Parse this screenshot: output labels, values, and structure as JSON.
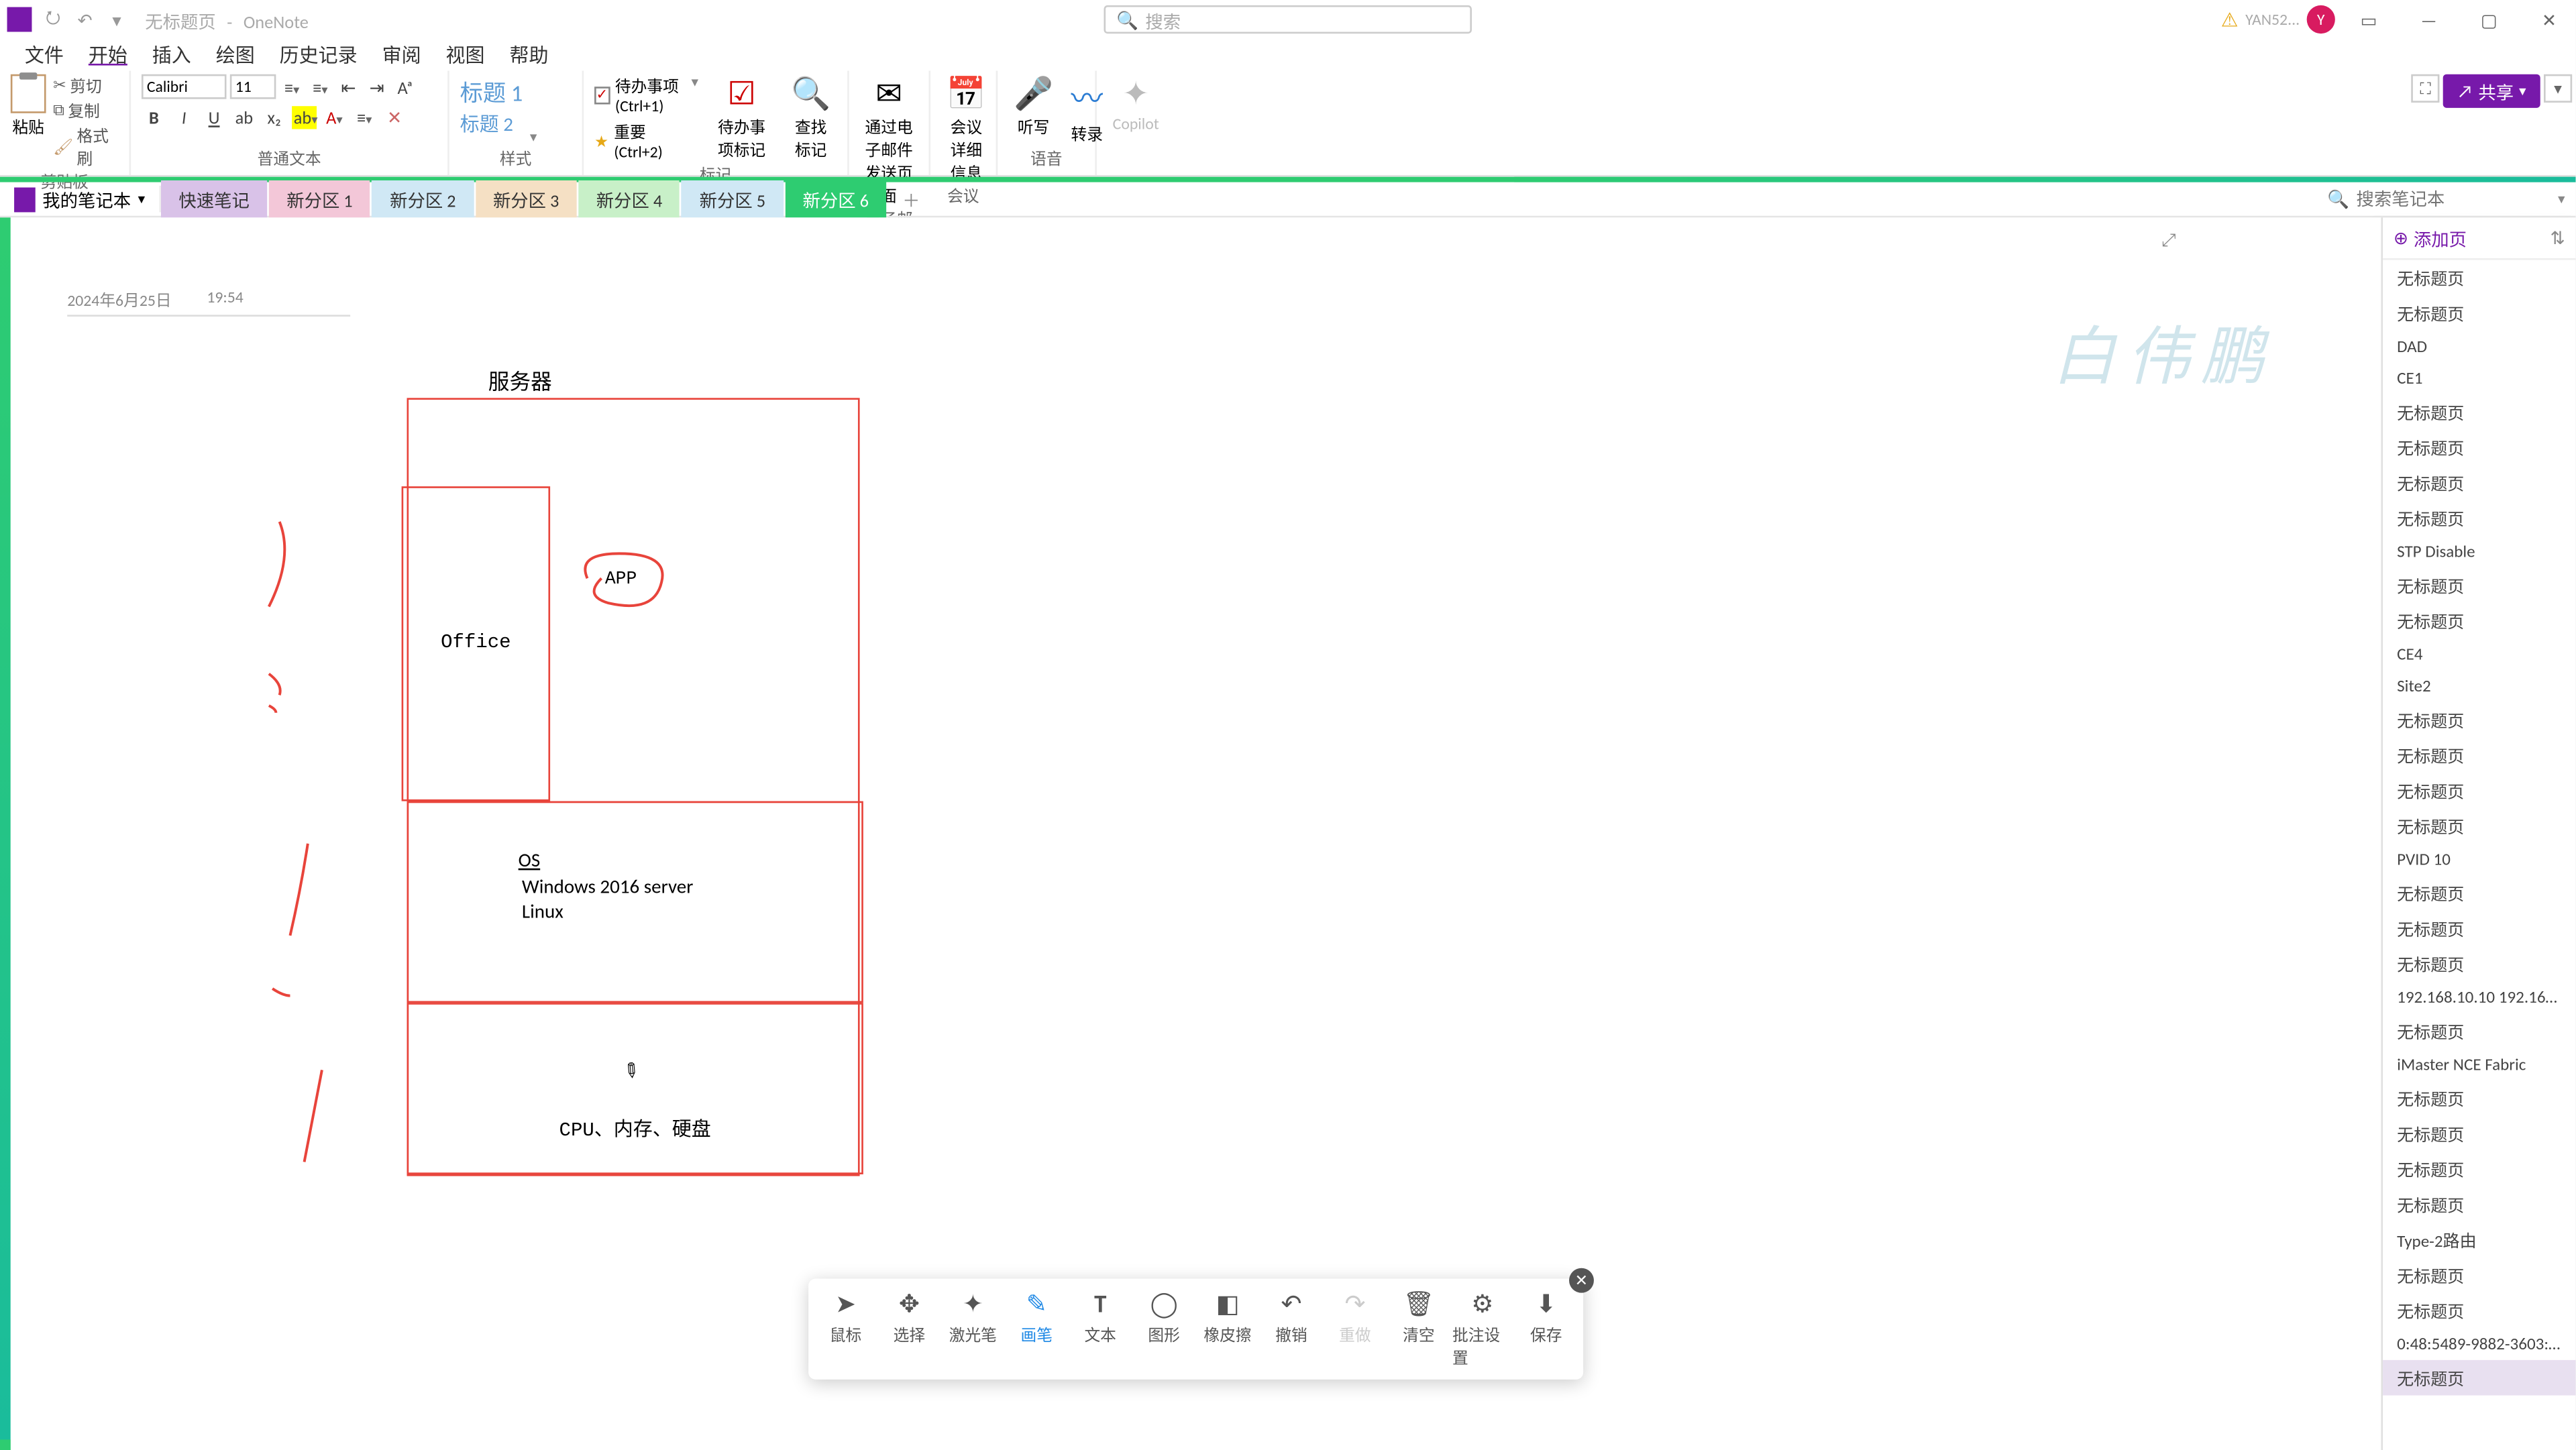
{
  "titlebar": {
    "breadcrumb_page": "无标题页",
    "breadcrumb_app": "OneNote",
    "search_placeholder": "搜索",
    "username": "YAN52...",
    "avatar_letter": "Y"
  },
  "menu": {
    "items": [
      "文件",
      "开始",
      "插入",
      "绘图",
      "历史记录",
      "审阅",
      "视图",
      "帮助"
    ],
    "active": 1
  },
  "ribbon": {
    "clipboard": {
      "paste": "粘贴",
      "cut": "剪切",
      "copy": "复制",
      "brush": "格式刷",
      "label": "剪贴板"
    },
    "font": {
      "name": "Calibri",
      "size": "11",
      "label": "普通文本"
    },
    "styles": {
      "h1": "标题 1",
      "h2": "标题 2",
      "label": "样式"
    },
    "tags": {
      "todo": "待办事项 (Ctrl+1)",
      "important": "重要 (Ctrl+2)",
      "find": "查找标记",
      "todo_btn": "待办事项标记",
      "label": "标记"
    },
    "mail": {
      "email": "通过电子邮件发送页面",
      "label": "电子邮件"
    },
    "meeting": {
      "detail": "会议详细信息",
      "label": "会议"
    },
    "voice": {
      "dictate": "听写",
      "transcribe": "转录",
      "label": "语音"
    },
    "copilot": "Copilot",
    "share": "共享"
  },
  "notebook": {
    "name": "我的笔记本",
    "sections": [
      "快速笔记",
      "新分区 1",
      "新分区 2",
      "新分区 3",
      "新分区 4",
      "新分区 5",
      "新分区 6"
    ],
    "search_placeholder": "搜索笔记本"
  },
  "page": {
    "date": "2024年6月25日",
    "time": "19:54",
    "diagram": {
      "title": "服务器",
      "office": "Office",
      "app": "APP",
      "os_heading": "OS",
      "os_line1": "Windows 2016 server",
      "os_line2": "Linux",
      "hw": "CPU、内存、硬盘"
    }
  },
  "pagelist": {
    "add": "添加页",
    "items": [
      "无标题页",
      "无标题页",
      "DAD",
      "CE1",
      "无标题页",
      "无标题页",
      "无标题页",
      "无标题页",
      "STP Disable",
      "无标题页",
      "无标题页",
      "CE4",
      "Site2",
      "无标题页",
      "无标题页",
      "无标题页",
      "无标题页",
      "PVID 10",
      "无标题页",
      "无标题页",
      "无标题页",
      "192.168.10.10 192.168...",
      "无标题页",
      "iMaster NCE Fabric",
      "无标题页",
      "无标题页",
      "无标题页",
      "无标题页",
      "Type-2路由",
      "无标题页",
      "无标题页",
      "0:48:5489-9882-3603:32...",
      "无标题页"
    ],
    "selected": 32
  },
  "anno": {
    "items": [
      "鼠标",
      "选择",
      "激光笔",
      "画笔",
      "文本",
      "图形",
      "橡皮擦",
      "撤销",
      "重做",
      "清空",
      "批注设置",
      "保存"
    ],
    "active": 3,
    "disabled": [
      8
    ]
  },
  "watermark": "白伟鹏"
}
